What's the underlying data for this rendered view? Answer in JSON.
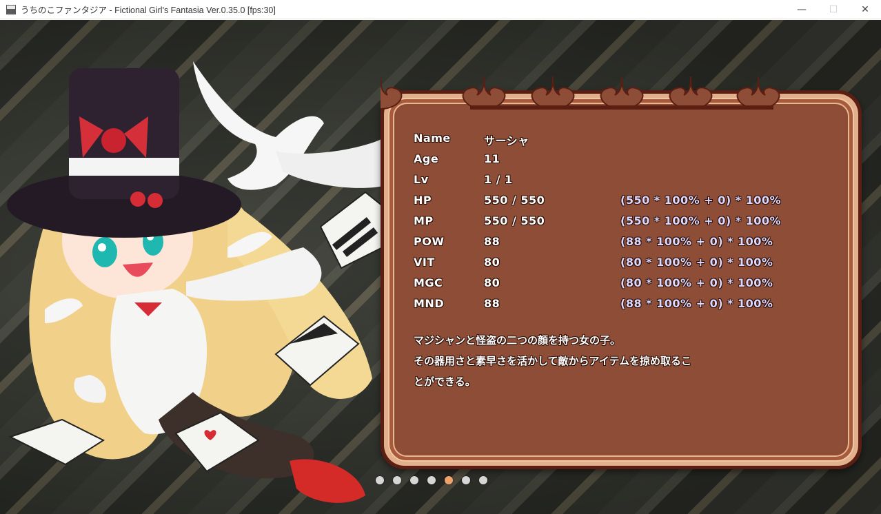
{
  "window": {
    "title": "うちのこファンタジア - Fictional Girl's Fantasia  Ver.0.35.0 [fps:30]",
    "icon": "app-window-icon",
    "controls": {
      "minimize": "—",
      "maximize": "☐",
      "close": "✕"
    }
  },
  "status": {
    "rows": [
      {
        "label": "Name",
        "value": "サーシャ",
        "formula": ""
      },
      {
        "label": "Age",
        "value": "11",
        "formula": ""
      },
      {
        "label": "Lv",
        "value": "1 / 1",
        "formula": ""
      },
      {
        "label": "HP",
        "value": "550 / 550",
        "formula": "(550 * 100% + 0) * 100%"
      },
      {
        "label": "MP",
        "value": "550 / 550",
        "formula": "(550 * 100% + 0) * 100%"
      },
      {
        "label": "POW",
        "value": "88",
        "formula": "(88 * 100% + 0) * 100%"
      },
      {
        "label": "VIT",
        "value": "80",
        "formula": "(80 * 100% + 0) * 100%"
      },
      {
        "label": "MGC",
        "value": "80",
        "formula": "(80 * 100% + 0) * 100%"
      },
      {
        "label": "MND",
        "value": "88",
        "formula": "(88 * 100% + 0) * 100%"
      }
    ],
    "description": [
      "マジシャンと怪盗の二つの顔を持つ女の子。",
      "その器用さと素早さを活かして敵からアイテムを掠め取るこ",
      "とができる。"
    ]
  },
  "pager": {
    "count": 7,
    "active_index": 4,
    "dot_color": "#d6d6d6",
    "active_color": "#f0a26c"
  },
  "colors": {
    "panel_fill": "#8e4d36",
    "panel_border": "#5a1f12",
    "formula_text": "#dcd8ff"
  }
}
